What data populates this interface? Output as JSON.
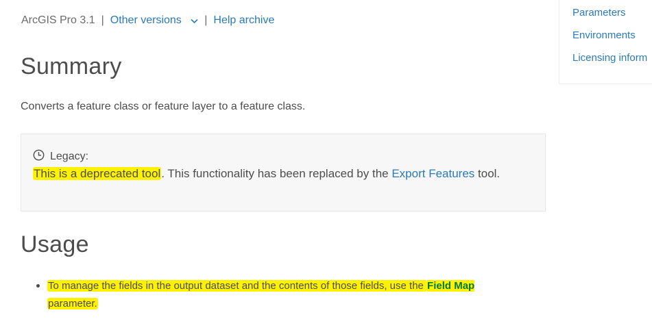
{
  "topbar": {
    "product_version": "ArcGIS Pro 3.1",
    "separator": "|",
    "other_versions": "Other versions",
    "help_archive": "Help archive"
  },
  "toc": {
    "items": [
      "Parameters",
      "Environments",
      "Licensing inform"
    ]
  },
  "summary": {
    "heading": "Summary",
    "text": "Converts a feature class or feature layer to a feature class."
  },
  "legacy": {
    "label": "Legacy:",
    "highlighted": "This is a deprecated tool",
    "text_before_link": ". This functionality has been replaced by the ",
    "link": "Export Features",
    "text_after_link": " tool."
  },
  "usage": {
    "heading": "Usage",
    "items": [
      {
        "highlighted": "To manage the fields in the output dataset and the contents of those fields, use the ",
        "param": "Field Map",
        "param_tail": "parameter."
      }
    ]
  },
  "colors": {
    "link": "#2a7ab8",
    "highlight": "#fff200",
    "text": "#4c4c4c"
  }
}
